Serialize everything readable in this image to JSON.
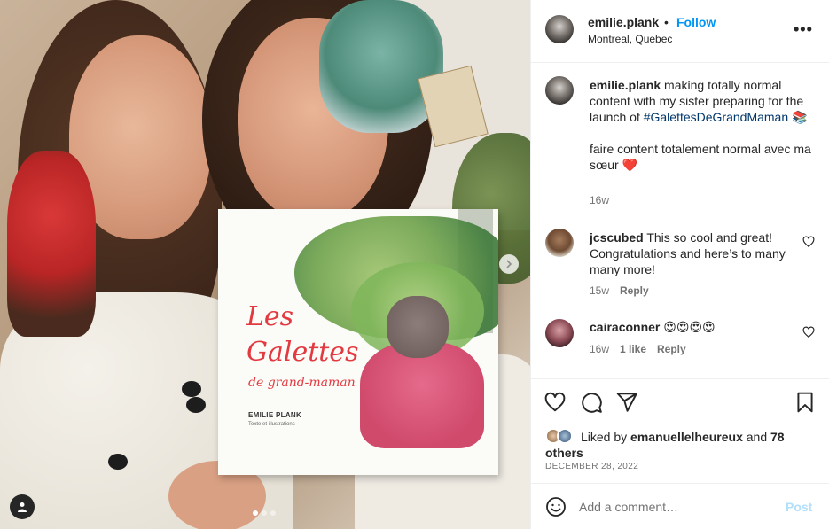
{
  "post": {
    "carousel": {
      "slide_count": 3,
      "active_slide": 1
    }
  },
  "header": {
    "username": "emilie.plank",
    "separator": "•",
    "follow_label": "Follow",
    "location": "Montreal, Quebec",
    "more_label": "•••"
  },
  "book": {
    "title_line1": "Les",
    "title_line2": "Galettes",
    "title_line3": "de grand-maman",
    "author": "EMILIE PLANK",
    "subtitle": "Texte et illustrations"
  },
  "caption": {
    "username": "emilie.plank",
    "text_before_tag": " making totally normal content with my sister preparing for the launch of ",
    "hashtag": "#GalettesDeGrandMaman",
    "emoji": "📚",
    "line2": "faire content totalement normal avec ma sœur",
    "line2_emoji": "❤️",
    "age": "16w"
  },
  "comments": [
    {
      "username": "jcscubed",
      "text": " This so cool and great! Congratulations and here’s to many many more!",
      "age": "15w",
      "likes": "",
      "reply_label": "Reply"
    },
    {
      "username": "cairaconner",
      "text": " 😍😍😍😍",
      "age": "16w",
      "likes": "1 like",
      "reply_label": "Reply"
    }
  ],
  "likes": {
    "prefix": "Liked by ",
    "user": "emanuellelheureux",
    "middle": " and ",
    "others": "78 others"
  },
  "date": "DECEMBER 28, 2022",
  "add_comment": {
    "placeholder": "Add a comment…",
    "post_label": "Post"
  },
  "icons": {
    "like": "heart-icon",
    "comment": "comment-icon",
    "share": "paper-plane-icon",
    "save": "bookmark-icon",
    "emoji": "smiley-icon",
    "next": "chevron-right-icon",
    "user_tags": "person-icon"
  },
  "colors": {
    "accent": "#0095f6",
    "hashtag": "#00376b",
    "post_disabled": "#b2dffc",
    "muted": "#737373"
  }
}
